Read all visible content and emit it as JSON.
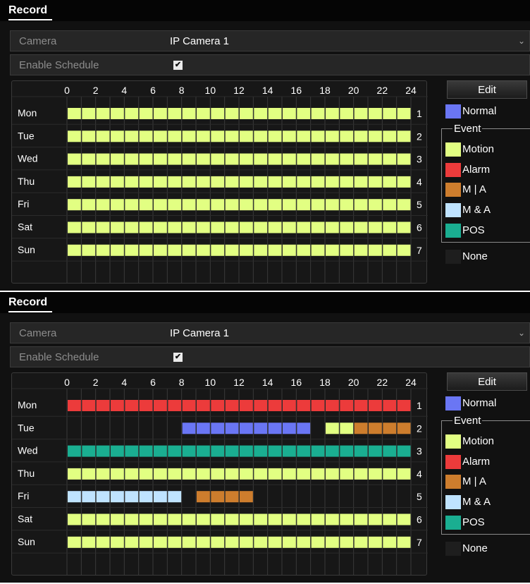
{
  "colors": {
    "normal": "#6a76f4",
    "motion": "#e2ff82",
    "alarm": "#ec3b3b",
    "m_or_a": "#cd7d2d",
    "m_and_a": "#bfe3ff",
    "pos": "#1aae91",
    "none": "#1e1e1e"
  },
  "panels": [
    {
      "header": "Record",
      "camera_label": "Camera",
      "camera_value": "IP Camera 1",
      "enable_label": "Enable Schedule",
      "enable_checked": "✔",
      "hour_ticks": [
        "0",
        "2",
        "4",
        "6",
        "8",
        "10",
        "12",
        "14",
        "16",
        "18",
        "20",
        "22",
        "24"
      ],
      "days": [
        {
          "label": "Mon",
          "num": "1",
          "segments": [
            {
              "start": 0,
              "end": 24,
              "type": "motion"
            }
          ]
        },
        {
          "label": "Tue",
          "num": "2",
          "segments": [
            {
              "start": 0,
              "end": 24,
              "type": "motion"
            }
          ]
        },
        {
          "label": "Wed",
          "num": "3",
          "segments": [
            {
              "start": 0,
              "end": 24,
              "type": "motion"
            }
          ]
        },
        {
          "label": "Thu",
          "num": "4",
          "segments": [
            {
              "start": 0,
              "end": 24,
              "type": "motion"
            }
          ]
        },
        {
          "label": "Fri",
          "num": "5",
          "segments": [
            {
              "start": 0,
              "end": 24,
              "type": "motion"
            }
          ]
        },
        {
          "label": "Sat",
          "num": "6",
          "segments": [
            {
              "start": 0,
              "end": 24,
              "type": "motion"
            }
          ]
        },
        {
          "label": "Sun",
          "num": "7",
          "segments": [
            {
              "start": 0,
              "end": 24,
              "type": "motion"
            }
          ]
        }
      ],
      "edit_label": "Edit",
      "legend": {
        "normal": "Normal",
        "event_title": "Event",
        "motion": "Motion",
        "alarm": "Alarm",
        "m_or_a": "M | A",
        "m_and_a": "M & A",
        "pos": "POS",
        "none": "None"
      }
    },
    {
      "header": "Record",
      "camera_label": "Camera",
      "camera_value": "IP Camera 1",
      "enable_label": "Enable Schedule",
      "enable_checked": "✔",
      "hour_ticks": [
        "0",
        "2",
        "4",
        "6",
        "8",
        "10",
        "12",
        "14",
        "16",
        "18",
        "20",
        "22",
        "24"
      ],
      "days": [
        {
          "label": "Mon",
          "num": "1",
          "segments": [
            {
              "start": 0,
              "end": 24,
              "type": "alarm"
            }
          ]
        },
        {
          "label": "Tue",
          "num": "2",
          "segments": [
            {
              "start": 8,
              "end": 17,
              "type": "normal"
            },
            {
              "start": 18,
              "end": 20,
              "type": "motion"
            },
            {
              "start": 20,
              "end": 24,
              "type": "m_or_a"
            }
          ]
        },
        {
          "label": "Wed",
          "num": "3",
          "segments": [
            {
              "start": 0,
              "end": 24,
              "type": "pos"
            }
          ]
        },
        {
          "label": "Thu",
          "num": "4",
          "segments": [
            {
              "start": 0,
              "end": 24,
              "type": "motion"
            }
          ]
        },
        {
          "label": "Fri",
          "num": "5",
          "segments": [
            {
              "start": 0,
              "end": 8,
              "type": "m_and_a"
            },
            {
              "start": 9,
              "end": 13,
              "type": "m_or_a"
            }
          ]
        },
        {
          "label": "Sat",
          "num": "6",
          "segments": [
            {
              "start": 0,
              "end": 24,
              "type": "motion"
            }
          ]
        },
        {
          "label": "Sun",
          "num": "7",
          "segments": [
            {
              "start": 0,
              "end": 24,
              "type": "motion"
            }
          ]
        }
      ],
      "edit_label": "Edit",
      "legend": {
        "normal": "Normal",
        "event_title": "Event",
        "motion": "Motion",
        "alarm": "Alarm",
        "m_or_a": "M | A",
        "m_and_a": "M & A",
        "pos": "POS",
        "none": "None"
      }
    }
  ]
}
